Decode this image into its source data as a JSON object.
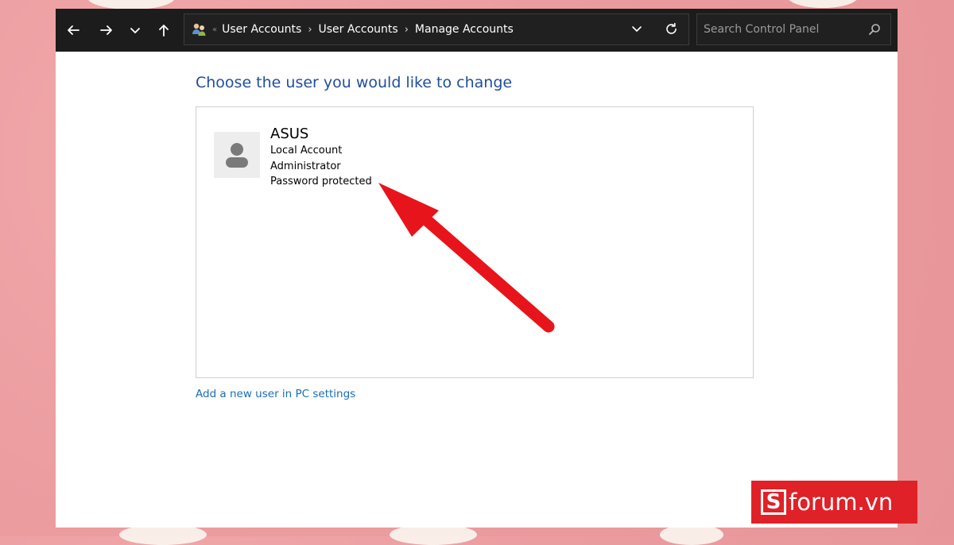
{
  "address_bar": {
    "breadcrumbs": [
      "User Accounts",
      "User Accounts",
      "Manage Accounts"
    ],
    "location_icon": "user-accounts-icon"
  },
  "nav": {
    "back_icon": "arrow-left-icon",
    "forward_icon": "arrow-right-icon",
    "recent_icon": "chevron-down-icon",
    "up_icon": "arrow-up-icon",
    "refresh_icon": "refresh-icon"
  },
  "search": {
    "placeholder": "Search Control Panel",
    "value": ""
  },
  "main": {
    "heading": "Choose the user you would like to change",
    "users": [
      {
        "name": "ASUS",
        "account_type": "Local Account",
        "role": "Administrator",
        "status": "Password protected"
      }
    ],
    "add_user_link": "Add a new user in PC settings"
  },
  "watermark": {
    "text": "forum.vn",
    "badge_letter": "S"
  },
  "colors": {
    "heading": "#1f4e9c",
    "link": "#1a6db4",
    "titlebar": "#1c1c1c",
    "arrow": "#e8141b",
    "watermark": "#e02127",
    "background": "#eb9c9f"
  }
}
